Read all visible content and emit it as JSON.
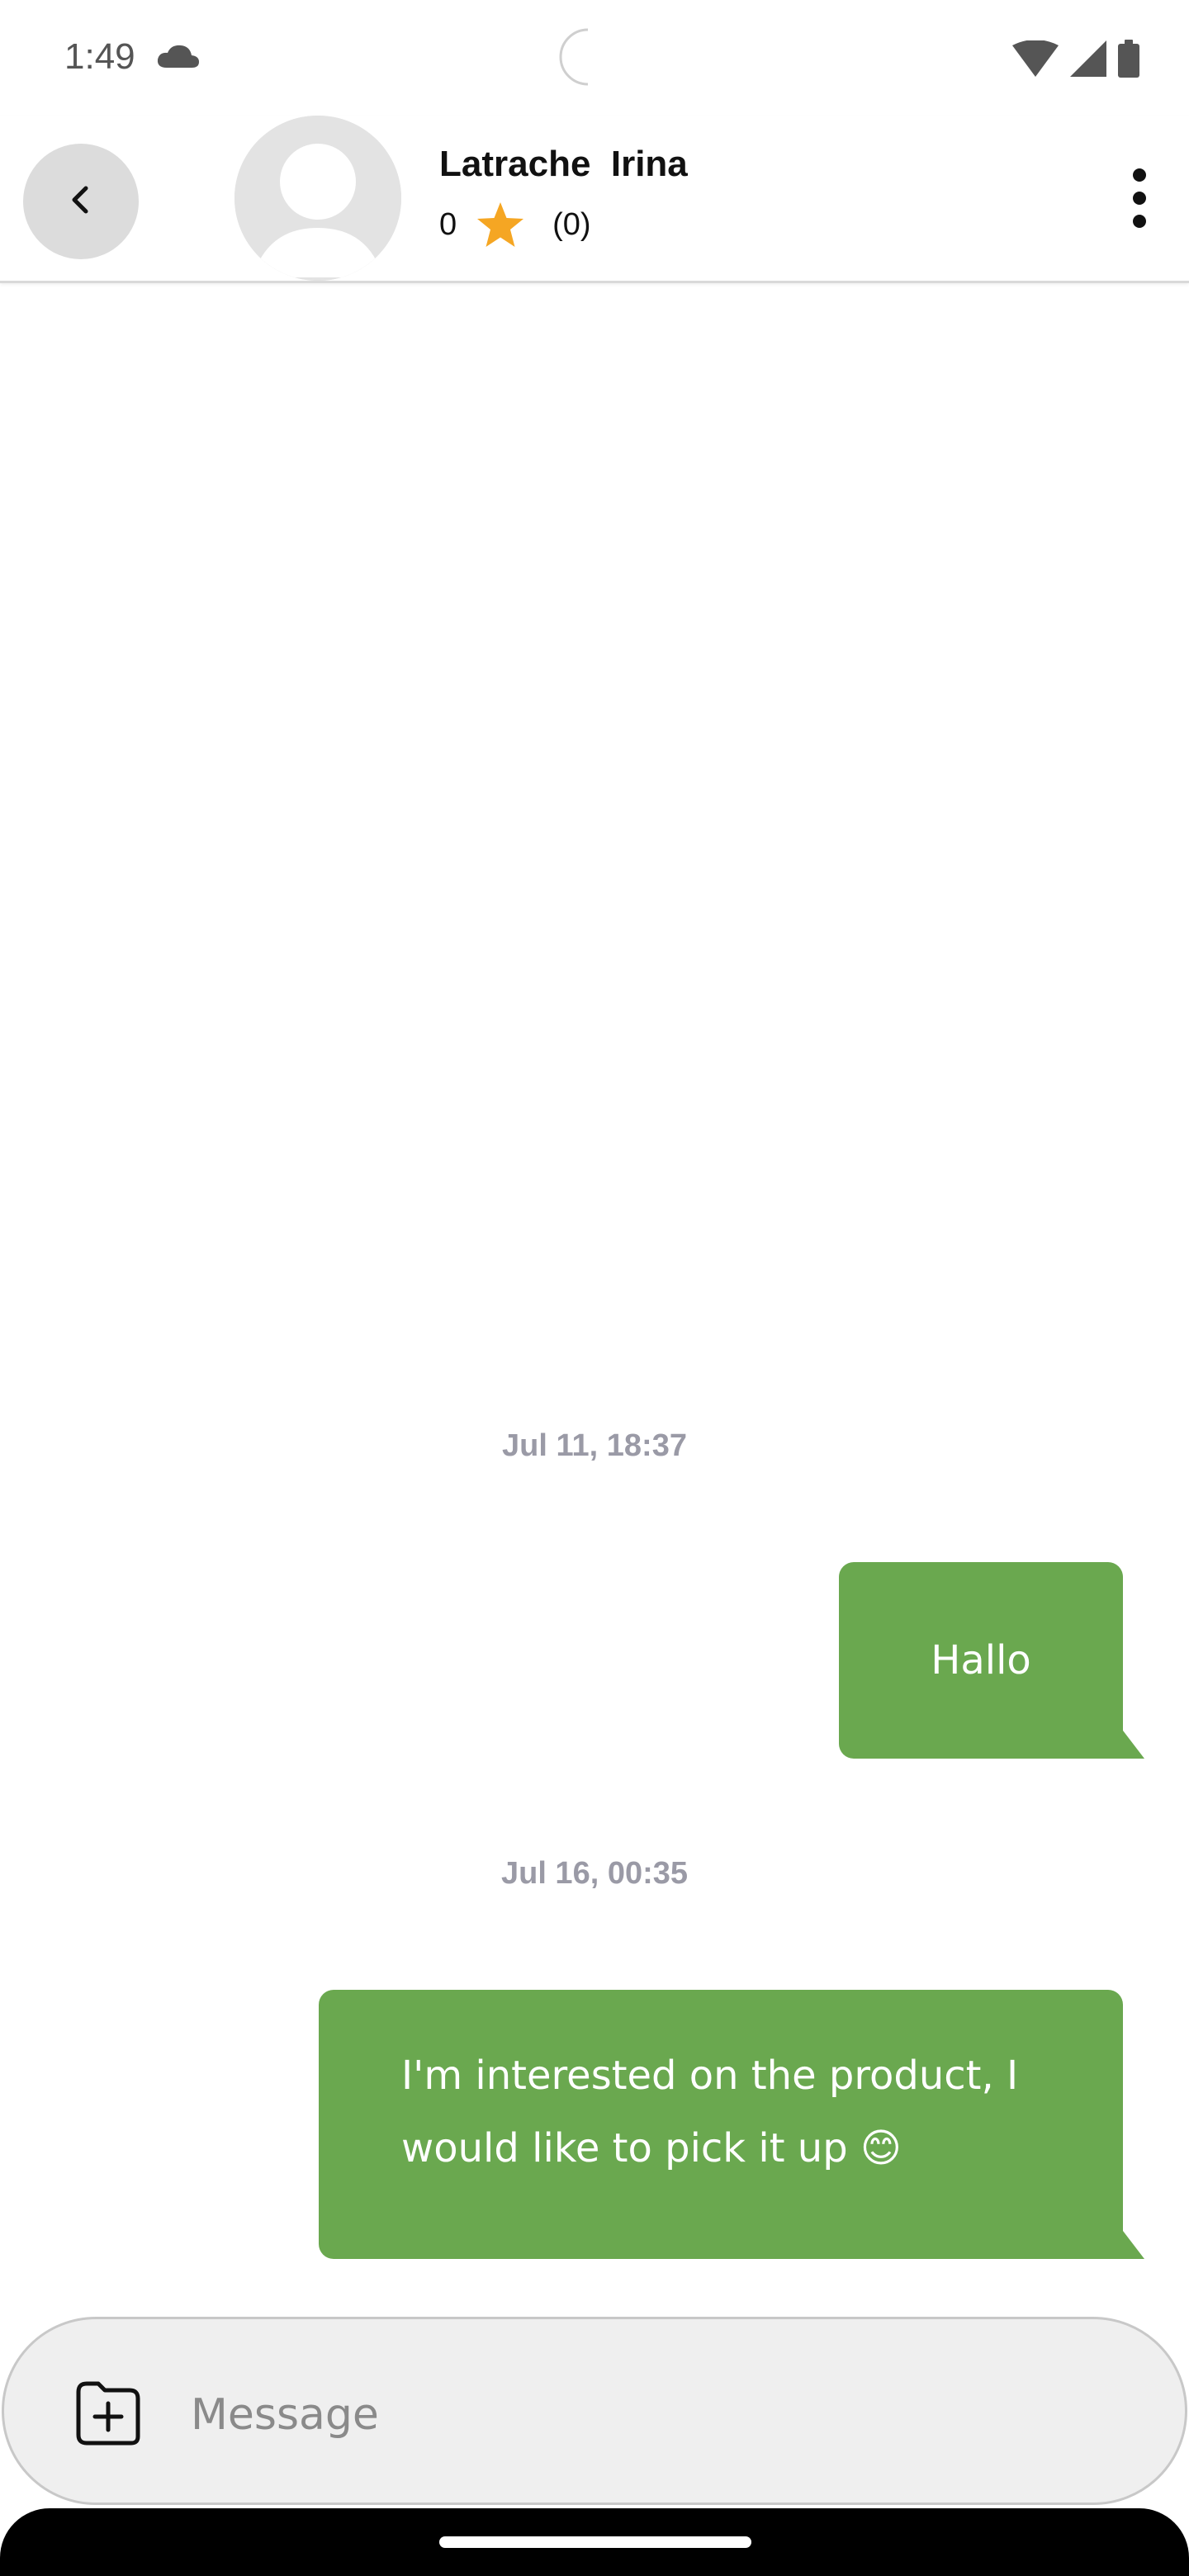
{
  "status_bar": {
    "time": "1:49",
    "icons": [
      "cloud-icon",
      "wifi-icon",
      "signal-icon",
      "battery-icon"
    ]
  },
  "header": {
    "contact_name": "Latrache  Irina",
    "rating_value": "0",
    "rating_count": "(0)",
    "star_color": "#f5a623",
    "icons": [
      "back-arrow-icon",
      "avatar-placeholder-icon",
      "star-icon",
      "more-vertical-icon"
    ]
  },
  "messages": [
    {
      "timestamp": "Jul 11, 18:37",
      "text": "Hallo",
      "direction": "outgoing"
    },
    {
      "timestamp": "Jul 16, 00:35",
      "text": "I'm interested on the product, I would like to pick it up 😊",
      "direction": "outgoing"
    }
  ],
  "composer": {
    "placeholder": "Message",
    "value": "",
    "icon": "attach-file-icon"
  },
  "colors": {
    "bubble": "#6aa84f",
    "timestamp": "#9a9aa6",
    "composer_bg": "#efefef"
  }
}
